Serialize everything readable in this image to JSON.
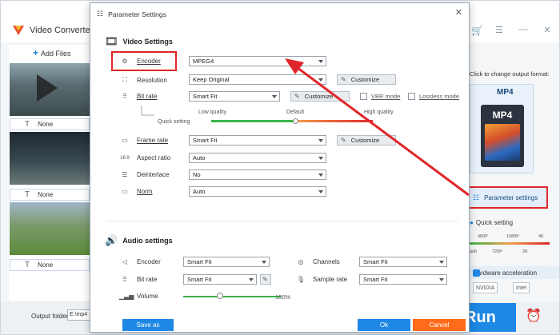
{
  "app": {
    "title": "Video Converter",
    "add_files_label": "Add Files",
    "subtitle_rows": [
      "None",
      "None",
      "None"
    ],
    "output_folder_label": "Output folder:",
    "output_folder_value": "E:\\mp4",
    "format_hint": "Click to change output format:",
    "format_name": "MP4",
    "format_icon_label": "MP4",
    "parameter_settings_label": "Parameter settings",
    "quick_setting_label": "Quick setting",
    "quick_ticks_top": [
      "480P",
      "1080P",
      "4K"
    ],
    "quick_ticks_bottom": [
      "ault",
      "720P",
      "2K"
    ],
    "hw_accel_label": "Hardware acceleration",
    "gpu_nvidia": "NVIDIA",
    "gpu_intel": "Intel",
    "run_label": "Run",
    "accent_color": "#1e88e5",
    "highlight_color": "#e0262b"
  },
  "dialog": {
    "title": "Parameter Settings",
    "video_section": "Video Settings",
    "audio_section": "Audio settings",
    "video": {
      "encoder": {
        "label": "Encoder",
        "value": "MPEG4"
      },
      "resolution": {
        "label": "Resolution",
        "value": "Keep Original",
        "customize": "Customize"
      },
      "bitrate": {
        "label": "Bit rate",
        "value": "Smart Fit",
        "customize": "Customize",
        "vbr": "VBR mode",
        "lossless": "Lossless mode"
      },
      "quick_setting": {
        "label": "Quick setting",
        "low": "Low quality",
        "default": "Default",
        "high": "High quality"
      },
      "framerate": {
        "label": "Frame rate",
        "value": "Smart Fit",
        "customize": "Customize"
      },
      "aspect": {
        "label": "Aspect ratio",
        "value": "Auto"
      },
      "deinterlace": {
        "label": "Deinterlace",
        "value": "No"
      },
      "norm": {
        "label": "Norm",
        "value": "Auto"
      }
    },
    "audio": {
      "encoder": {
        "label": "Encoder",
        "value": "Smart Fit"
      },
      "channels": {
        "label": "Channels",
        "value": "Smart Fit"
      },
      "bitrate": {
        "label": "Bit rate",
        "value": "Smart Fit"
      },
      "samplerate": {
        "label": "Sample rate",
        "value": "Smart Fit"
      },
      "volume": {
        "label": "Volume",
        "value": "100%",
        "level": 0.38
      }
    },
    "save_as": "Save as",
    "ok": "Ok",
    "cancel": "Cancel"
  }
}
